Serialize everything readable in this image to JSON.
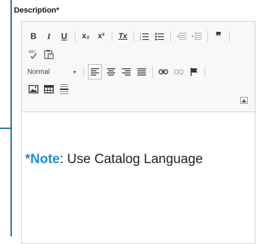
{
  "field": {
    "label": "Description*"
  },
  "toolbar": {
    "row1": {
      "bold": "B",
      "italic": "I",
      "underline": "U",
      "subscript": "x₂",
      "superscript": "x²",
      "remove_format": "Tx",
      "numbered_list": "numbered-list-icon",
      "bulleted_list": "bulleted-list-icon",
      "decrease_indent": "outdent-icon",
      "increase_indent": "indent-icon",
      "blockquote": "❞"
    },
    "row2": {
      "spellcheck": "spellcheck-icon",
      "paste_text": "paste-text-icon"
    },
    "row3": {
      "format_value": "Normal"
    },
    "row4": {
      "image": "image-icon",
      "table": "table-icon",
      "horizontal_line": "horizontal-line-icon"
    }
  },
  "content": {
    "note_prefix": "*Note",
    "note_body": ": Use Catalog Language"
  },
  "colors": {
    "accent": "#1a8fd6",
    "bar": "#2c6e96"
  }
}
